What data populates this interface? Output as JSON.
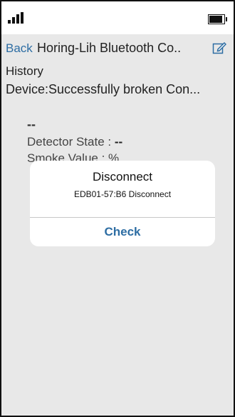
{
  "navbar": {
    "back_label": "Back",
    "title": "Horing-Lih Bluetooth Co.."
  },
  "content": {
    "history_label": "History",
    "device_status": "Device:Successfully broken Con...",
    "dashes": "--",
    "detector_label": "Detector State : ",
    "detector_value": "--",
    "smoke_label": "Smoke Value :  %"
  },
  "dialog": {
    "title": "Disconnect",
    "message": "EDB01-57:B6 Disconnect",
    "button_label": "Check"
  },
  "colors": {
    "accent": "#2d6da3",
    "background": "#e8e8e8"
  },
  "icons": {
    "status_left": "signal-icon",
    "status_right": "battery-icon",
    "nav_right": "edit-icon"
  }
}
